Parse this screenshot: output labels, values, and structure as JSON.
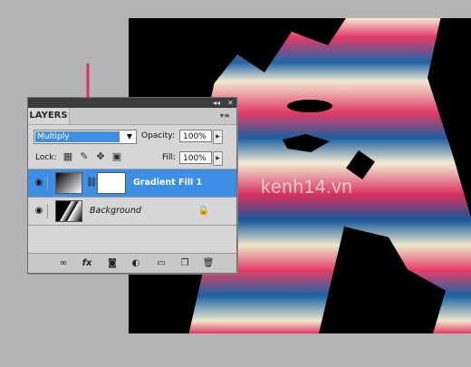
{
  "watermark": "kenh14.vn",
  "panel": {
    "tab_label": "LAYERS",
    "title_controls": "◂◂",
    "close_glyph": "✕",
    "menu_glyph": "▾≡",
    "blend_mode": "Multiply",
    "opacity_label": "Opacity:",
    "opacity_value": "100%",
    "lock_label": "Lock:",
    "fill_label": "Fill:",
    "fill_value": "100%",
    "layers": [
      {
        "name": "Gradient Fill 1",
        "selected": true,
        "visible": true,
        "thumbnail": "gradient-fill-icon"
      },
      {
        "name": "Background",
        "selected": false,
        "visible": true,
        "locked": true,
        "thumbnail": "photo-thumbnail"
      }
    ],
    "bottom_icons": [
      "link-layers-icon",
      "fx-icon",
      "add-mask-icon",
      "adjustment-layer-icon",
      "group-folder-icon",
      "new-layer-icon",
      "trash-icon"
    ],
    "fx_label": "fx"
  },
  "colors": {
    "accent": "#3d8fe6",
    "arrow": "#d9325e",
    "panel_bg": "#d6d6d6",
    "workspace": "#b4b4b4"
  }
}
